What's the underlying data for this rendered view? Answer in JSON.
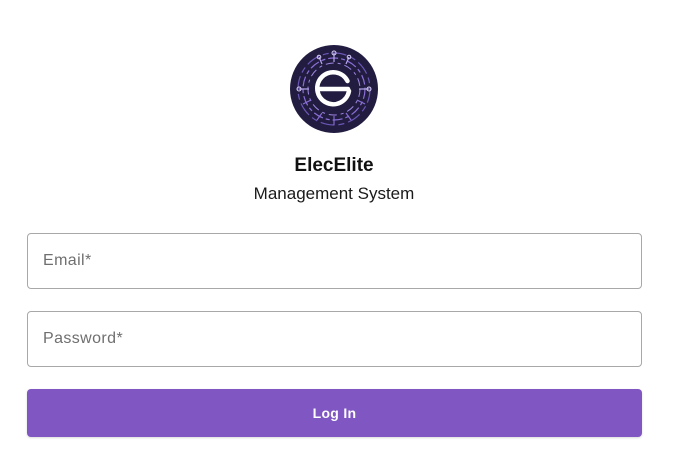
{
  "brand": {
    "name": "ElecElite",
    "subtitle": "Management System",
    "logo_icon": "circuit-e-logo-icon"
  },
  "form": {
    "email_placeholder": "Email*",
    "password_placeholder": "Password*",
    "login_label": "Log In"
  },
  "colors": {
    "primary": "#7f56c2",
    "logo_background": "#221c40",
    "logo_accent": "#8a6fd6"
  }
}
